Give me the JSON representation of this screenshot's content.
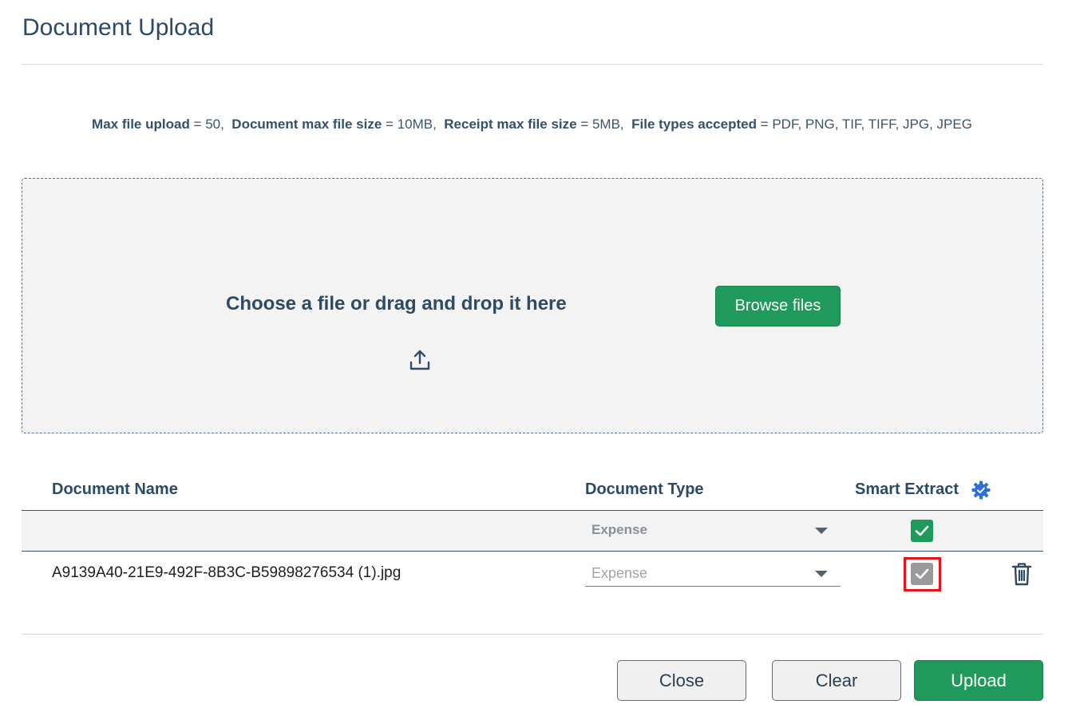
{
  "dialog": {
    "title": "Document Upload"
  },
  "limits": {
    "max_upload_label": "Max file upload",
    "max_upload_value": " = 50,",
    "doc_size_label": "Document max file size",
    "doc_size_value": " = 10MB,",
    "receipt_size_label": "Receipt max file size",
    "receipt_size_value": " = 5MB,",
    "types_label": "File types accepted",
    "types_value": " = PDF, PNG, TIF, TIFF, JPG, JPEG"
  },
  "dropzone": {
    "prompt": "Choose a file or drag and drop it here",
    "browse_label": "Browse files",
    "icon": "upload-icon"
  },
  "table": {
    "headers": {
      "name": "Document Name",
      "type": "Document Type",
      "smart_extract": "Smart Extract"
    },
    "settings_icon": "gear-icon",
    "bulk_row": {
      "type": "Expense",
      "smart_extract_checked": true
    },
    "rows": [
      {
        "name": "A9139A40-21E9-492F-8B3C-B59898276534 (1).jpg",
        "type": "Expense",
        "smart_extract_checked": true,
        "delete_icon": "trash-icon"
      }
    ]
  },
  "footer": {
    "close_label": "Close",
    "clear_label": "Clear",
    "upload_label": "Upload"
  },
  "colors": {
    "accent": "#1f9a5a",
    "heading": "#2b4a66",
    "highlight": "#e8101a"
  }
}
